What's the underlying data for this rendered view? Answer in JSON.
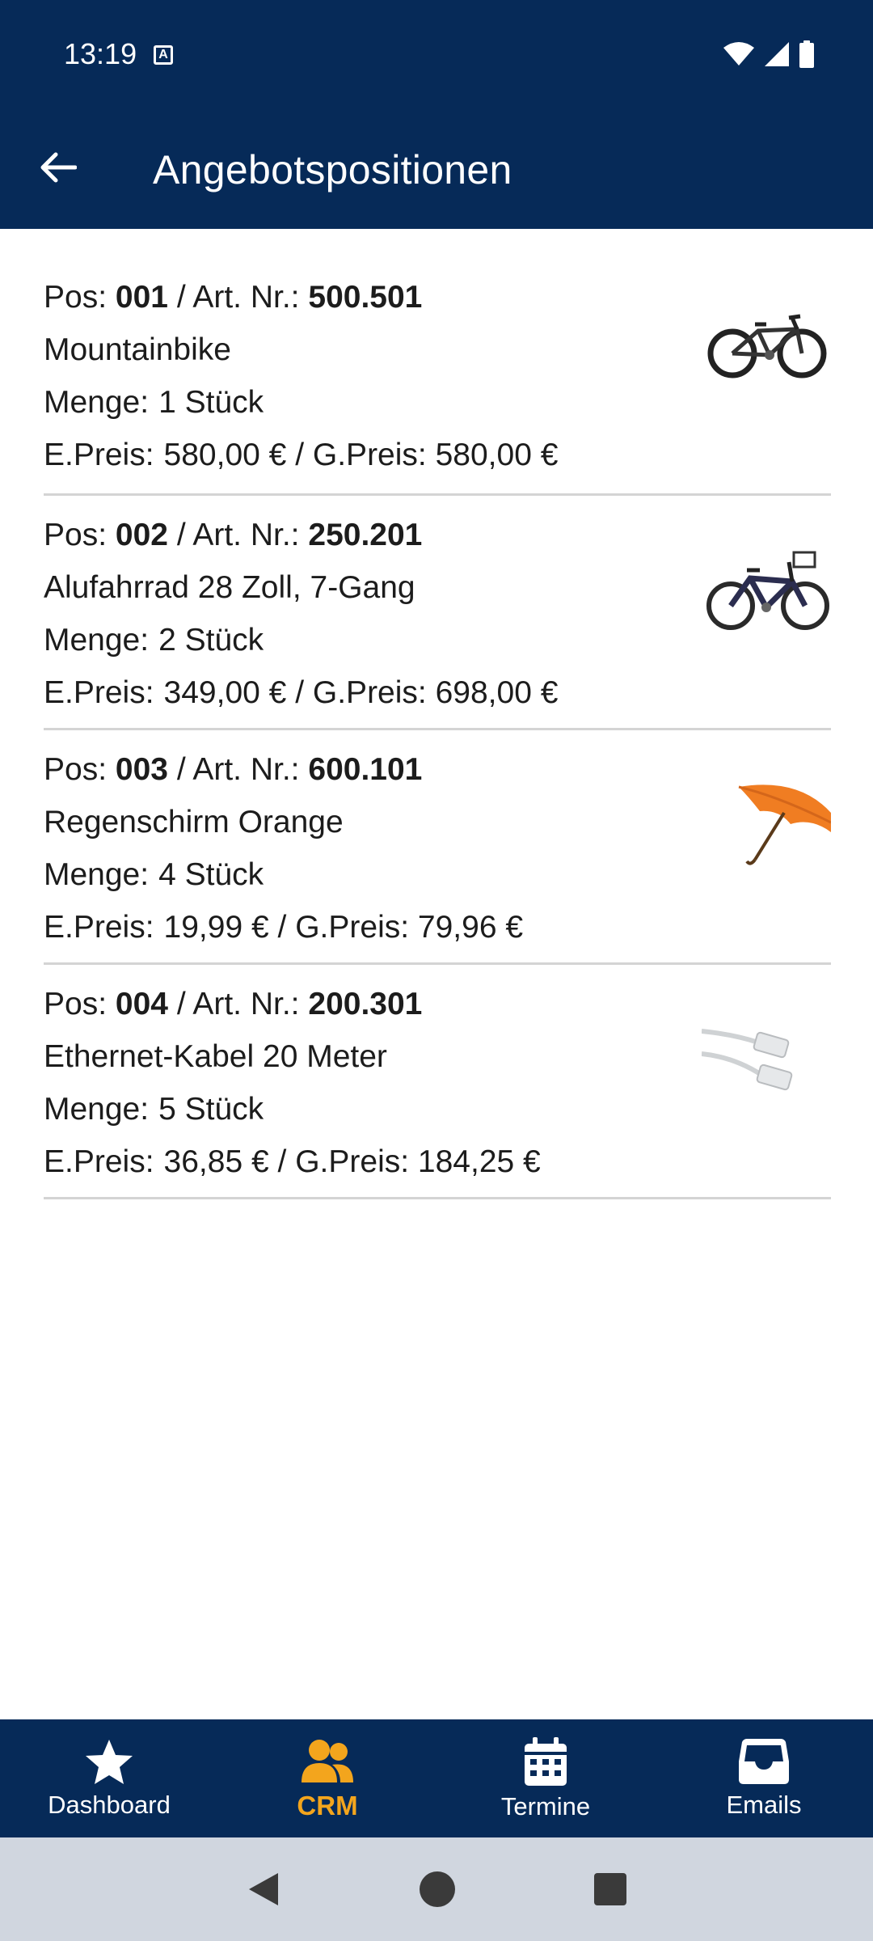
{
  "status": {
    "time": "13:19",
    "indicator": "A"
  },
  "header": {
    "title": "Angebotspositionen",
    "back_icon": "arrow-left-icon"
  },
  "labels": {
    "pos": "Pos:",
    "sep": "/",
    "art": "Art. Nr.:",
    "menge": "Menge:",
    "epreis": "E.Preis:",
    "gpreis": "G.Preis:"
  },
  "items": [
    {
      "pos": "001",
      "art_nr": "500.501",
      "name": "Mountainbike",
      "qty": "1",
      "unit": "Stück",
      "e_preis": "580,00 €",
      "g_preis": "580,00 €",
      "image": "mountainbike-image"
    },
    {
      "pos": "002",
      "art_nr": "250.201",
      "name": "Alufahrrad 28 Zoll, 7-Gang",
      "qty": "2",
      "unit": "Stück",
      "e_preis": "349,00 €",
      "g_preis": "698,00 €",
      "image": "city-bike-image"
    },
    {
      "pos": "003",
      "art_nr": "600.101",
      "name": "Regenschirm Orange",
      "qty": "4",
      "unit": "Stück",
      "e_preis": "19,99 €",
      "g_preis": "79,96 €",
      "image": "orange-umbrella-image"
    },
    {
      "pos": "004",
      "art_nr": "200.301",
      "name": "Ethernet-Kabel 20 Meter",
      "qty": "5",
      "unit": "Stück",
      "e_preis": "36,85 €",
      "g_preis": "184,25 €",
      "image": "ethernet-cable-image"
    }
  ],
  "nav": {
    "items": [
      {
        "label": "Dashboard",
        "icon": "star-icon"
      },
      {
        "label": "CRM",
        "icon": "users-icon"
      },
      {
        "label": "Termine",
        "icon": "calendar-icon"
      },
      {
        "label": "Emails",
        "icon": "inbox-icon"
      }
    ],
    "active": "CRM"
  },
  "colors": {
    "primary": "#062a58",
    "accent": "#f3a51d",
    "divider": "#d4d4d4",
    "system_nav": "#d0d6df"
  }
}
